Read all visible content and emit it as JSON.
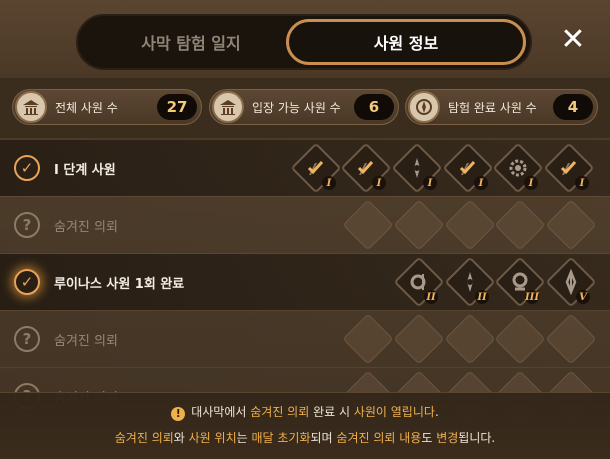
{
  "tabs": [
    {
      "label": "사막 탐험 일지",
      "active": false
    },
    {
      "label": "사원 정보",
      "active": true
    }
  ],
  "close_icon": "close-icon",
  "stats": [
    {
      "label": "전체 사원 수",
      "value": "27",
      "icon": "temple-icon"
    },
    {
      "label": "입장 가능 사원 수",
      "value": "6",
      "icon": "temple-icon"
    },
    {
      "label": "탐험 완료 사원 수",
      "value": "4",
      "icon": "compass-icon"
    }
  ],
  "rows": [
    {
      "label": "Ⅰ 단계 사원",
      "status": "check",
      "tiers": [
        "I",
        "I",
        "I",
        "I",
        "I",
        "I"
      ]
    },
    {
      "label": "숨겨진 의뢰",
      "status": "question"
    },
    {
      "label": "루이나스 사원 1회 완료",
      "status": "check",
      "tiers": [
        "II",
        "II",
        "III",
        "V"
      ]
    },
    {
      "label": "숨겨진 의뢰",
      "status": "question"
    },
    {
      "label": "숨겨진 의뢰",
      "status": "question"
    }
  ],
  "footer": {
    "line1": {
      "a": "대사막에서 ",
      "b": "숨겨진 의뢰",
      "c": " 완료 시 ",
      "d": "사원이 열립니다",
      "e": "."
    },
    "line2": {
      "a": "숨겨진 의뢰",
      "b": "와 ",
      "c": "사원 위치",
      "d": "는 ",
      "e": "매달 초기화",
      "f": "되며 ",
      "g": "숨겨진 의뢰 내용",
      "h": "도 ",
      "i": "변경",
      "j": "됩니다."
    }
  },
  "colors": {
    "accent": "#c98f52",
    "highlight": "#f0b04a",
    "tier": "#f1b45c"
  }
}
